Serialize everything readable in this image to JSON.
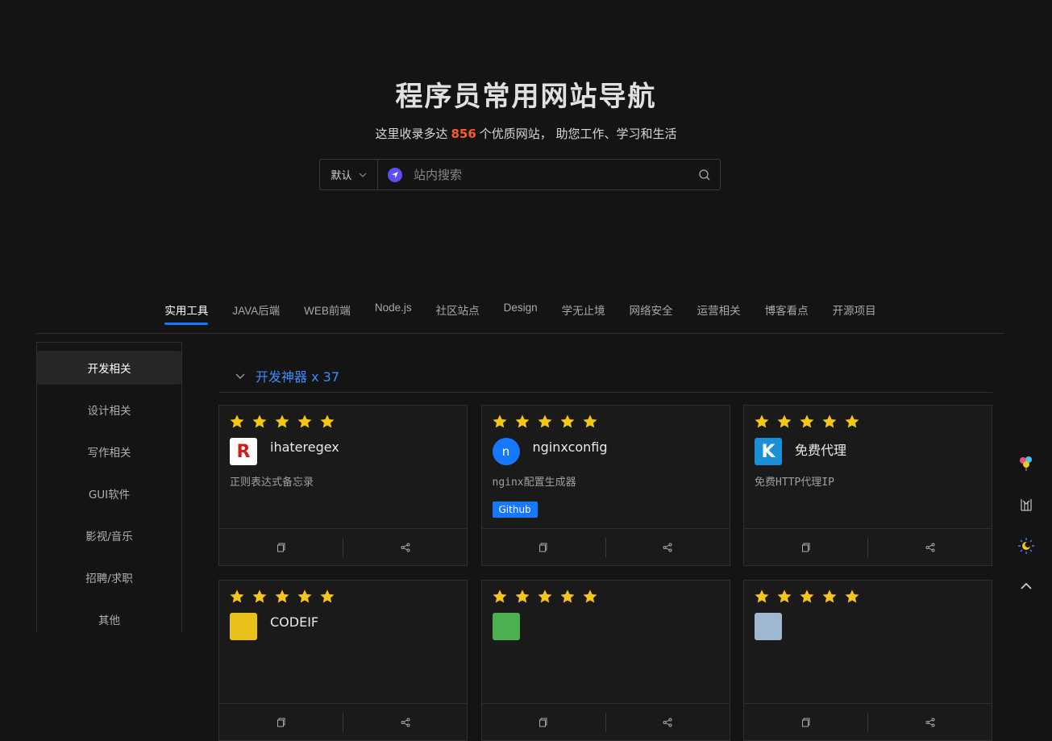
{
  "hero": {
    "title": "程序员常用网站导航",
    "subtitle_prefix": "这里收录多达",
    "count": "856",
    "subtitle_suffix": "个优质网站， 助您工作、学习和生活"
  },
  "search": {
    "engine_label": "默认",
    "placeholder": "站内搜索",
    "value": ""
  },
  "tabs": [
    {
      "label": "实用工具",
      "active": true
    },
    {
      "label": "JAVA后端"
    },
    {
      "label": "WEB前端"
    },
    {
      "label": "Node.js"
    },
    {
      "label": "社区站点"
    },
    {
      "label": "Design"
    },
    {
      "label": "学无止境"
    },
    {
      "label": "网络安全"
    },
    {
      "label": "运营相关"
    },
    {
      "label": "博客看点"
    },
    {
      "label": "开源项目"
    }
  ],
  "sidebar": {
    "items": [
      {
        "label": "开发相关",
        "active": true
      },
      {
        "label": "设计相关"
      },
      {
        "label": "写作相关"
      },
      {
        "label": "GUI软件"
      },
      {
        "label": "影视/音乐"
      },
      {
        "label": "招聘/求职"
      },
      {
        "label": "其他"
      }
    ]
  },
  "section": {
    "title": "开发神器 x 37"
  },
  "cards": [
    {
      "name": "ihateregex",
      "desc": "正则表达式备忘录",
      "tag": "",
      "rating": 5,
      "logo_text": "R",
      "logo_bg": "#ffffff",
      "logo_fg": "#d11a1a"
    },
    {
      "name": "nginxconfig",
      "desc": "nginx配置生成器",
      "tag": "Github",
      "rating": 5,
      "logo_text": "n",
      "logo_bg": "#1677ff",
      "logo_fg": "#ffffff"
    },
    {
      "name": "免费代理",
      "desc": "免费HTTP代理IP",
      "tag": "",
      "rating": 5,
      "logo_text": "K",
      "logo_bg": "#1a8fd8",
      "logo_fg": "#ffffff"
    },
    {
      "name": "CODEIF",
      "desc": "",
      "tag": "",
      "rating": 5,
      "logo_text": "",
      "logo_bg": "#e8c21a",
      "logo_fg": "#d11a1a"
    },
    {
      "name": "",
      "desc": "",
      "tag": "",
      "rating": 5,
      "logo_text": "",
      "logo_bg": "#4caf50",
      "logo_fg": "#ffffff"
    },
    {
      "name": "",
      "desc": "",
      "tag": "",
      "rating": 5,
      "logo_text": "",
      "logo_bg": "#9fb8d0",
      "logo_fg": "#ffffff"
    }
  ],
  "colors": {
    "accent": "#1677ff",
    "highlight": "#ff5a1f",
    "star": "#f5c518",
    "section_title": "#3d8bff"
  },
  "icons": {
    "search_engine": "navigation-arrow-icon",
    "search": "search-icon",
    "collapse": "chevron-down-icon",
    "copy": "copy-icon",
    "share": "share-icon",
    "rail": [
      "balloons-icon",
      "library-icon",
      "theme-sun-moon-icon",
      "back-to-top-icon"
    ]
  }
}
